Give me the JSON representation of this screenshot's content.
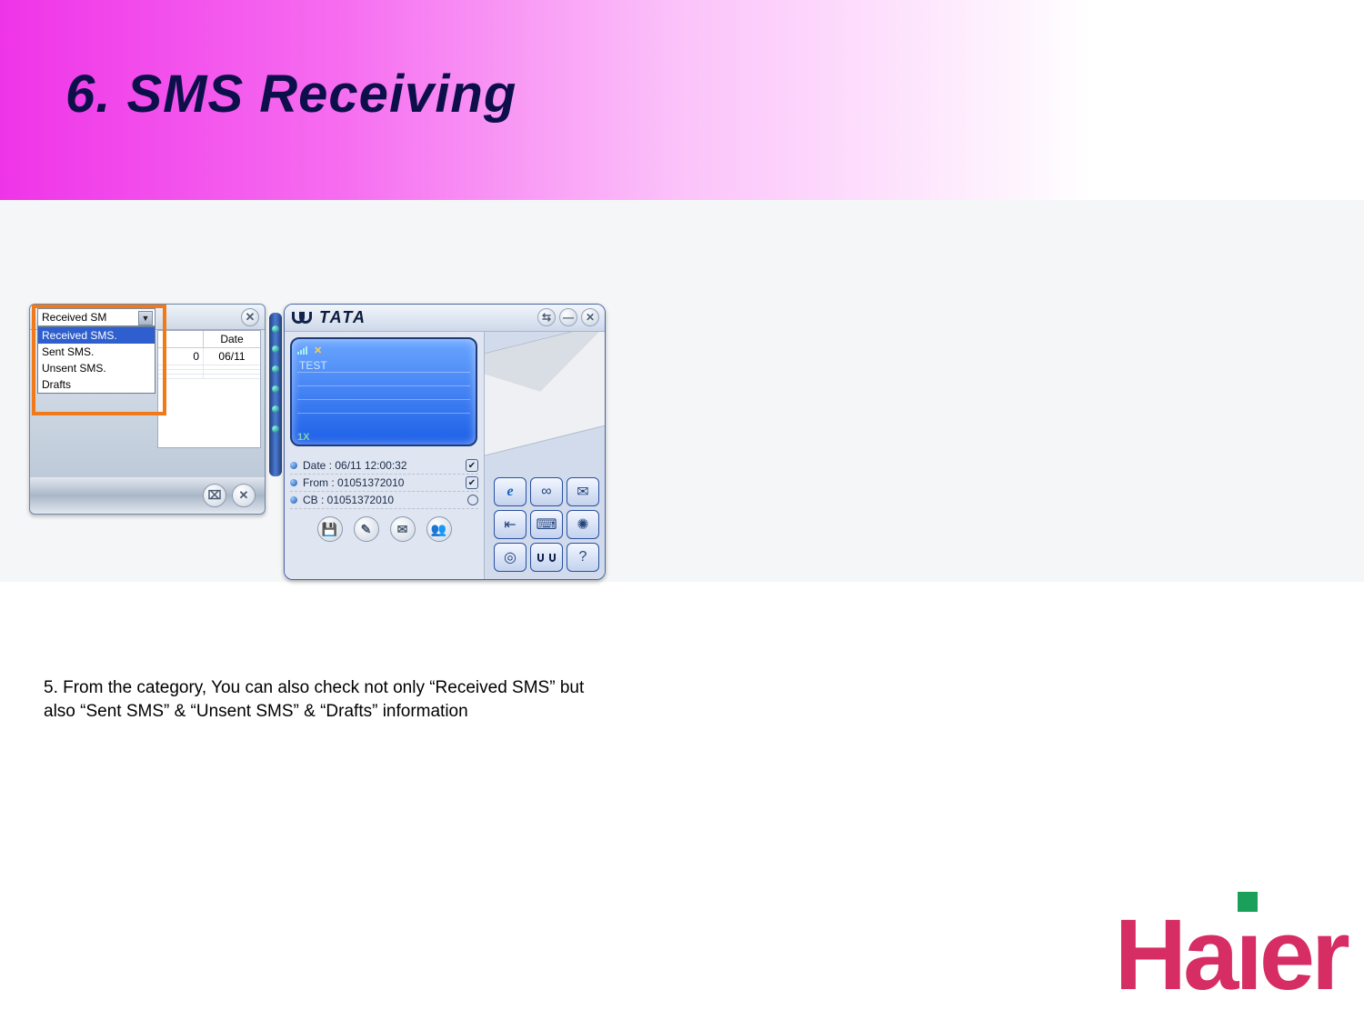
{
  "header": {
    "title": "6. SMS Receiving"
  },
  "left_panel": {
    "combo_value": "Received SM",
    "dropdown_options": [
      "Received SMS.",
      "Sent SMS.",
      "Unsent SMS.",
      "Drafts"
    ],
    "table": {
      "headers": {
        "col1": "",
        "col2": "Date"
      },
      "rows": [
        {
          "col1": "0",
          "col2": "06/11"
        }
      ]
    },
    "buttons": {
      "delete_all": "⌧",
      "delete": "✕"
    },
    "close": "✕"
  },
  "right_panel": {
    "brand": "TATA",
    "window_controls": {
      "connect": "⇆",
      "minimize": "—",
      "close": "✕"
    },
    "screen": {
      "message": "TEST",
      "footer": "1X"
    },
    "info": [
      {
        "label": "Date : 06/11 12:00:32",
        "state": "checked"
      },
      {
        "label": "From : 01051372010",
        "state": "checked"
      },
      {
        "label": "CB : 01051372010",
        "state": "unchecked"
      }
    ],
    "action_icons": [
      {
        "name": "save-icon",
        "glyph": "💾"
      },
      {
        "name": "edit-icon",
        "glyph": "✎"
      },
      {
        "name": "reply-icon",
        "glyph": "✉"
      },
      {
        "name": "contact-icon",
        "glyph": "👥"
      }
    ],
    "app_icons": [
      {
        "name": "internet-icon",
        "glyph": "e",
        "cls": "e"
      },
      {
        "name": "call-log-icon",
        "glyph": "∞"
      },
      {
        "name": "compose-icon",
        "glyph": "✉"
      },
      {
        "name": "inbox-icon",
        "glyph": "⇤"
      },
      {
        "name": "keypad-icon",
        "glyph": "⌨"
      },
      {
        "name": "settings-icon",
        "glyph": "✺"
      },
      {
        "name": "camera-icon",
        "glyph": "◎"
      },
      {
        "name": "tata-icon",
        "glyph": "",
        "cls": "tata"
      },
      {
        "name": "help-icon",
        "glyph": "?"
      }
    ]
  },
  "body_text": "5. From the category, You can also check not only “Received SMS” but also “Sent SMS” & “Unsent SMS” & “Drafts” information",
  "brand_logo": "Haier"
}
